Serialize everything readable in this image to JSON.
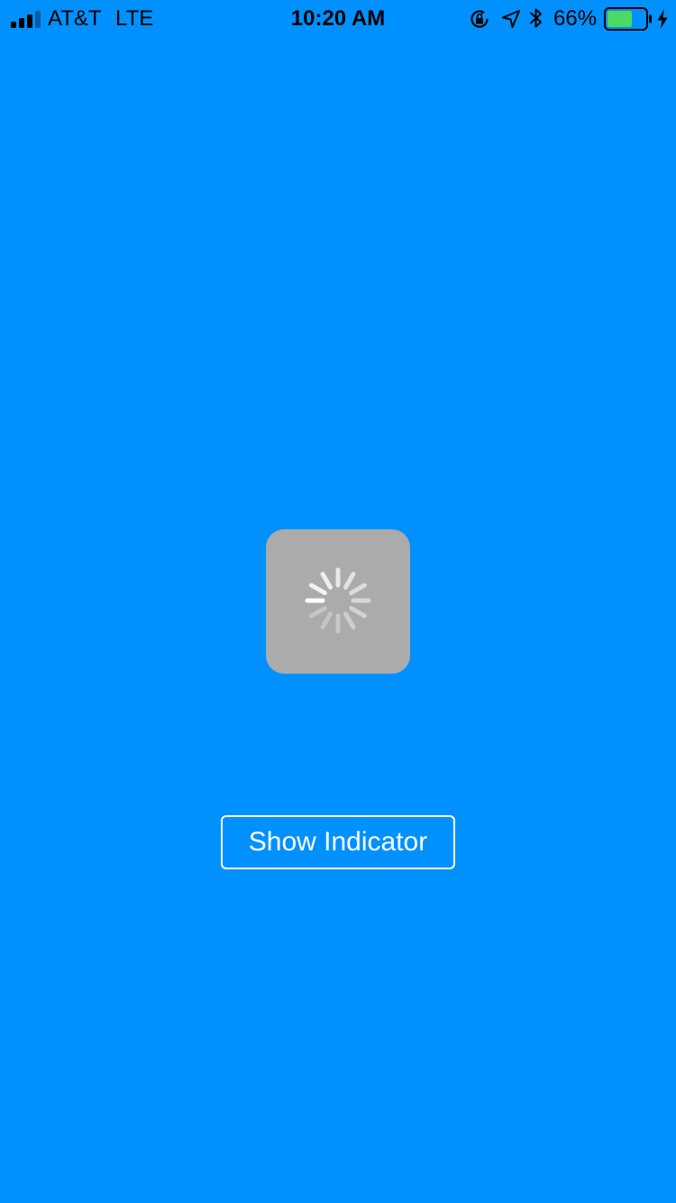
{
  "status_bar": {
    "carrier": "AT&T",
    "network": "LTE",
    "time": "10:20 AM",
    "battery_percent": "66%",
    "battery_level": 0.66,
    "signal_bars_filled": 3,
    "signal_bars_total": 4,
    "icons": [
      "signal-bars-icon",
      "rotation-lock-icon",
      "location-arrow-icon",
      "bluetooth-icon",
      "battery-icon",
      "charging-bolt-icon"
    ]
  },
  "loading_hud": {
    "icon": "activity-spinner-icon"
  },
  "show_indicator_button": {
    "label": "Show Indicator"
  },
  "colors": {
    "background": "#0091ff",
    "hud": "#ababab",
    "button_border": "#ffffff",
    "button_text": "#ffffff",
    "battery_fill": "#4cd964"
  }
}
